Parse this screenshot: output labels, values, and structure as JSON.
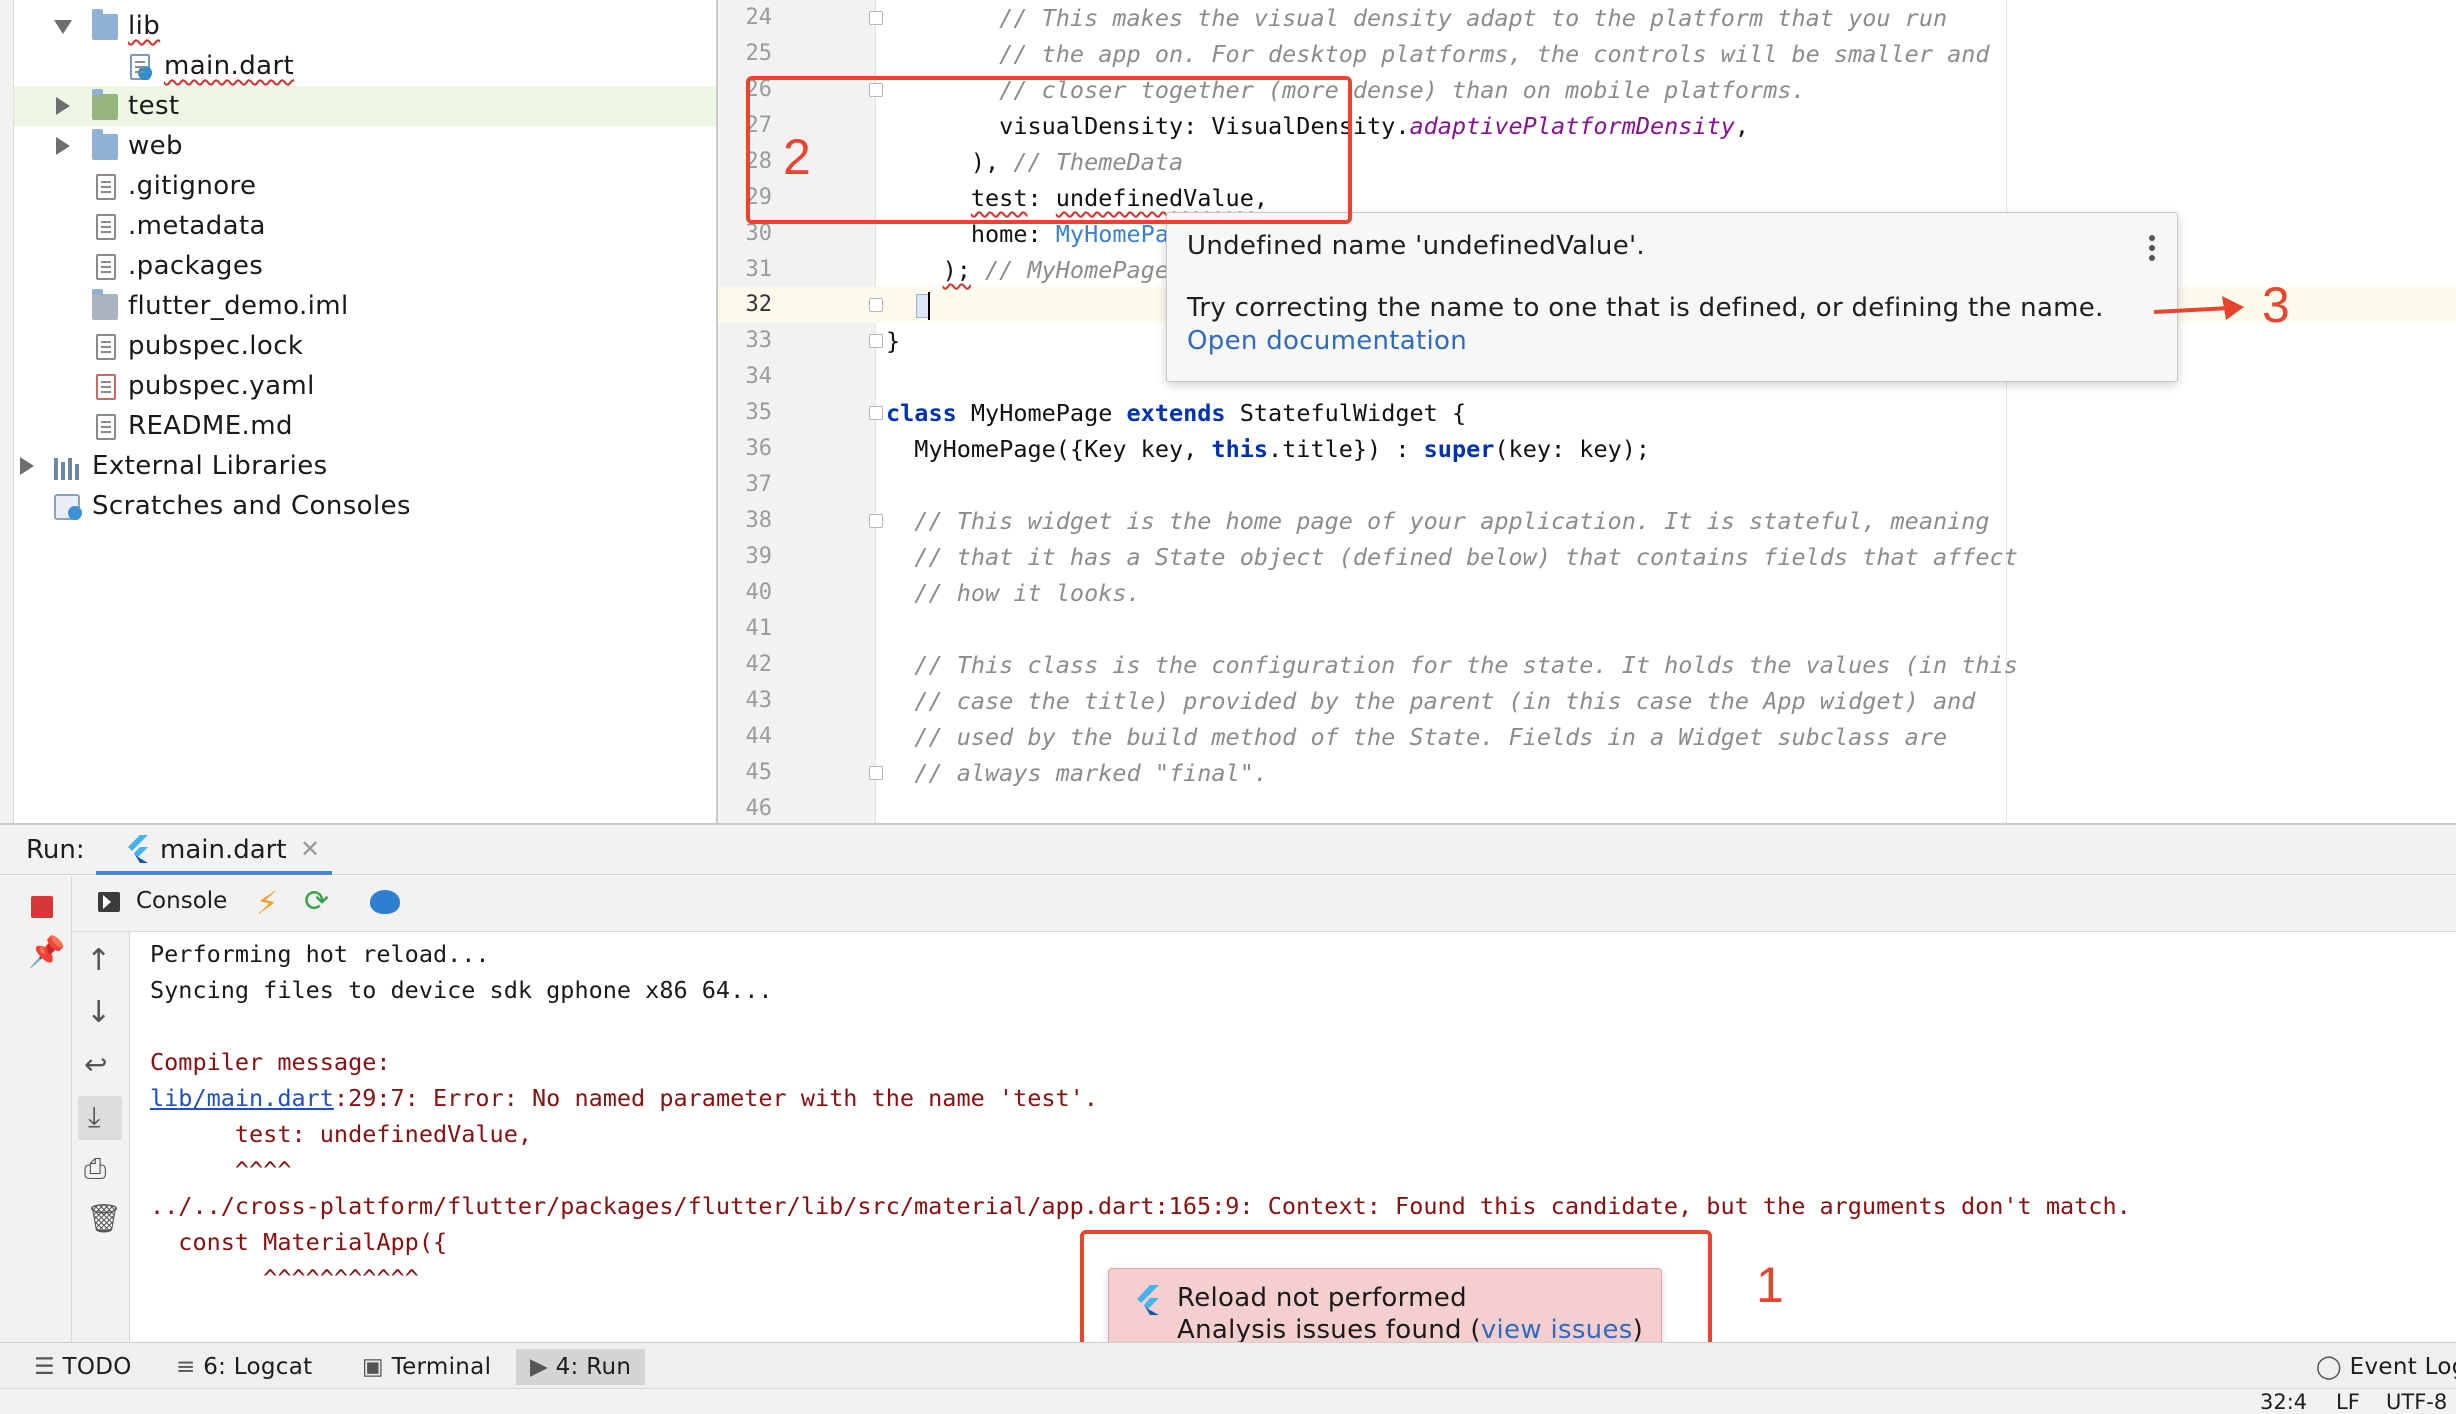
{
  "project_tree": {
    "items": [
      {
        "label": "lib",
        "icon": "folder-icon",
        "state": "expanded"
      },
      {
        "label": "main.dart",
        "icon": "dart-file-icon"
      },
      {
        "label": "test",
        "icon": "test-folder-icon",
        "state": "collapsed"
      },
      {
        "label": "web",
        "icon": "web-folder-icon",
        "state": "collapsed"
      },
      {
        "label": ".gitignore",
        "icon": "gitignore-file-icon"
      },
      {
        "label": ".metadata",
        "icon": "text-file-icon"
      },
      {
        "label": ".packages",
        "icon": "text-file-icon"
      },
      {
        "label": "flutter_demo.iml",
        "icon": "module-folder-icon"
      },
      {
        "label": "pubspec.lock",
        "icon": "text-file-icon"
      },
      {
        "label": "pubspec.yaml",
        "icon": "yaml-file-icon"
      },
      {
        "label": "README.md",
        "icon": "text-file-icon"
      },
      {
        "label": "External Libraries",
        "icon": "libraries-icon",
        "state": "collapsed"
      },
      {
        "label": "Scratches and Consoles",
        "icon": "scratches-icon"
      }
    ]
  },
  "editor": {
    "current_line": "32",
    "lines": [
      {
        "n": "24",
        "text": "        // This makes the visual density adapt to the platform that you run"
      },
      {
        "n": "25",
        "text": "        // the app on. For desktop platforms, the controls will be smaller and"
      },
      {
        "n": "26",
        "text": "        // closer together (more dense) than on mobile platforms."
      },
      {
        "n": "27",
        "p1": "        visualDensity: VisualDensity.",
        "p2": "adaptivePlatformDensity",
        "p3": ","
      },
      {
        "n": "28",
        "p1": "      ), ",
        "p2": "// ThemeData"
      },
      {
        "n": "29",
        "p1": "      ",
        "p2": "test",
        "p3": ": ",
        "p4": "undefinedValue",
        "p5": ","
      },
      {
        "n": "30",
        "p1": "      home: ",
        "p2": "MyHomePa"
      },
      {
        "n": "31",
        "p1": "    ",
        "p2": ");",
        "p3": " // MyHomePage"
      },
      {
        "n": "32",
        "text": "  }"
      },
      {
        "n": "33",
        "text": "}"
      },
      {
        "n": "34",
        "text": ""
      },
      {
        "n": "35",
        "k1": "class",
        "p1": " MyHomePage ",
        "k2": "extends",
        "p2": " StatefulWidget {"
      },
      {
        "n": "36",
        "p1": "  MyHomePage({Key key, ",
        "k1": "this",
        "p2": ".title}) : ",
        "k2": "super",
        "p3": "(key: key);"
      },
      {
        "n": "37",
        "text": ""
      },
      {
        "n": "38",
        "text": "  // This widget is the home page of your application. It is stateful, meaning"
      },
      {
        "n": "39",
        "text": "  // that it has a State object (defined below) that contains fields that affect"
      },
      {
        "n": "40",
        "text": "  // how it looks."
      },
      {
        "n": "41",
        "text": ""
      },
      {
        "n": "42",
        "text": "  // This class is the configuration for the state. It holds the values (in this"
      },
      {
        "n": "43",
        "text": "  // case the title) provided by the parent (in this case the App widget) and"
      },
      {
        "n": "44",
        "text": "  // used by the build method of the State. Fields in a Widget subclass are"
      },
      {
        "n": "45",
        "text": "  // always marked \"final\"."
      },
      {
        "n": "46",
        "text": ""
      }
    ]
  },
  "tooltip": {
    "title": "Undefined name 'undefinedValue'.",
    "message": "Try correcting the name to one that is defined, or defining the name.",
    "link": "Open documentation",
    "menu_icon": "more-vertical-icon"
  },
  "annotations": {
    "box1": "1",
    "box2": "2",
    "arrow3": "3",
    "color": "#e8452f"
  },
  "run_panel": {
    "label": "Run:",
    "tab": "main.dart",
    "console_tab": "Console",
    "console_lines": [
      {
        "text": "Performing hot reload...",
        "kind": "normal"
      },
      {
        "text": "Syncing files to device sdk gphone x86 64...",
        "kind": "normal"
      },
      {
        "text": "",
        "kind": "normal"
      },
      {
        "text": "Compiler message:",
        "kind": "error"
      },
      {
        "link": "lib/main.dart",
        "text": ":29:7: Error: No named parameter with the name 'test'.",
        "kind": "error"
      },
      {
        "text": "      test: undefinedValue,",
        "kind": "error"
      },
      {
        "text": "      ^^^^",
        "kind": "error"
      },
      {
        "text": "../../cross-platform/flutter/packages/flutter/lib/src/material/app.dart:165:9: Context: Found this candidate, but the arguments don't match.",
        "kind": "error"
      },
      {
        "text": "  const MaterialApp({",
        "kind": "error"
      },
      {
        "text": "        ^^^^^^^^^^^",
        "kind": "error"
      }
    ]
  },
  "notification": {
    "title": "Reload not performed",
    "message_prefix": "Analysis issues found (",
    "link": "view issues",
    "message_suffix": ")",
    "icon": "flutter-icon"
  },
  "tool_windows": [
    {
      "label": "TODO",
      "icon": "list-icon"
    },
    {
      "label": "6: Logcat",
      "icon": "logcat-icon"
    },
    {
      "label": "Terminal",
      "icon": "terminal-icon"
    },
    {
      "label": "4: Run",
      "icon": "run-icon",
      "active": true
    },
    {
      "label": "Event Log",
      "icon": "event-log-icon"
    }
  ],
  "status_bar": {
    "position": "32:4",
    "line_sep": "LF",
    "encoding": "UTF-8"
  },
  "colors": {
    "error_text": "#8a0f0f",
    "link": "#2f6bbf",
    "keyword": "#0033b3",
    "balloon": "#f5cfcf",
    "selection": "#eef6e4"
  }
}
